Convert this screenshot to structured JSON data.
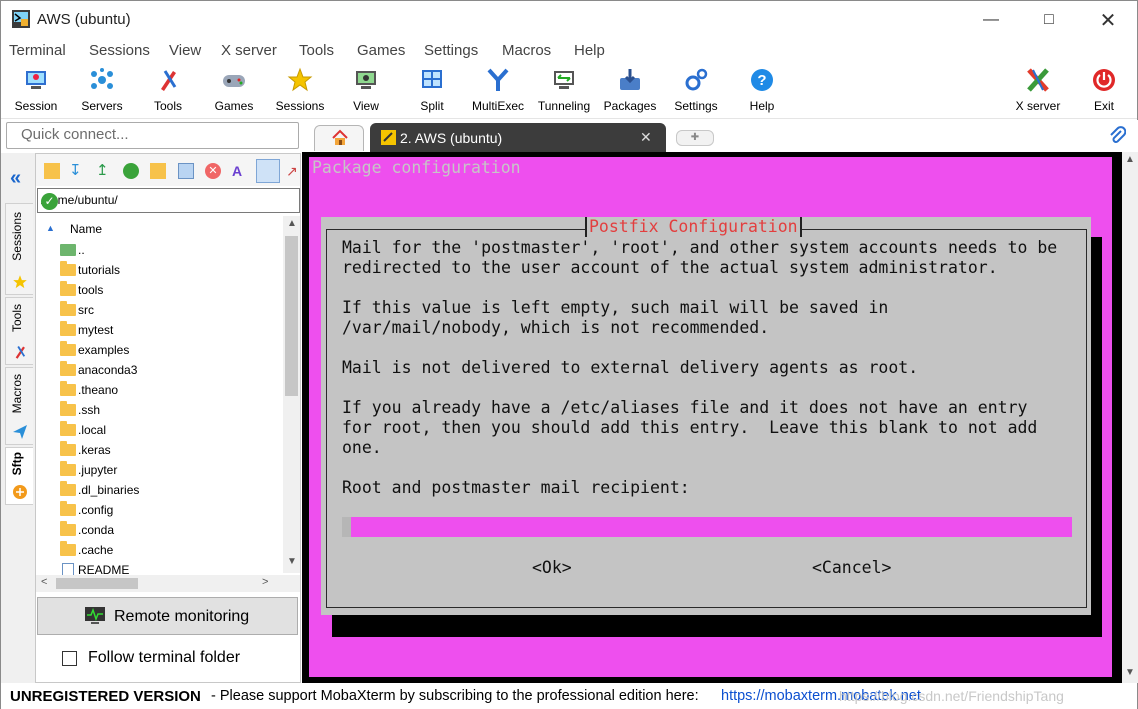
{
  "window": {
    "title": "AWS (ubuntu)"
  },
  "menu": [
    "Terminal",
    "Sessions",
    "View",
    "X server",
    "Tools",
    "Games",
    "Settings",
    "Macros",
    "Help"
  ],
  "toolbar": {
    "items": [
      "Session",
      "Servers",
      "Tools",
      "Games",
      "Sessions",
      "View",
      "Split",
      "MultiExec",
      "Tunneling",
      "Packages",
      "Settings",
      "Help"
    ],
    "xserver": "X server",
    "exit": "Exit"
  },
  "quick_connect": {
    "placeholder": "Quick connect..."
  },
  "tabs": {
    "active_label": "2. AWS (ubuntu)"
  },
  "side_tabs": {
    "sessions": "Sessions",
    "tools": "Tools",
    "macros": "Macros",
    "sftp": "Sftp"
  },
  "sftp": {
    "path": "/home/ubuntu/",
    "column_name": "Name",
    "files": [
      "..",
      "tutorials",
      "tools",
      "src",
      "mytest",
      "examples",
      "anaconda3",
      ".theano",
      ".ssh",
      ".local",
      ".keras",
      ".jupyter",
      ".dl_binaries",
      ".config",
      ".conda",
      ".cache",
      "README"
    ],
    "remote_monitoring": "Remote monitoring",
    "follow_terminal": "Follow terminal folder"
  },
  "terminal": {
    "header": "Package configuration",
    "dialog_title": "Postfix Configuration",
    "lines": [
      "Mail for the 'postmaster', 'root', and other system accounts needs to be",
      "redirected to the user account of the actual system administrator.",
      "",
      "If this value is left empty, such mail will be saved in",
      "/var/mail/nobody, which is not recommended.",
      "",
      "Mail is not delivered to external delivery agents as root.",
      "",
      "If you already have a /etc/aliases file and it does not have an entry",
      "for root, then you should add this entry.  Leave this blank to not add",
      "one.",
      "",
      "Root and postmaster mail recipient:"
    ],
    "ok": "<Ok>",
    "cancel": "<Cancel>"
  },
  "status": {
    "unregistered": "UNREGISTERED VERSION",
    "message": "-  Please support MobaXterm by subscribing to the professional edition here:",
    "link": "https://mobaxterm.mobatek.net",
    "watermark": "https://blog.csdn.net/FriendshipTang"
  }
}
